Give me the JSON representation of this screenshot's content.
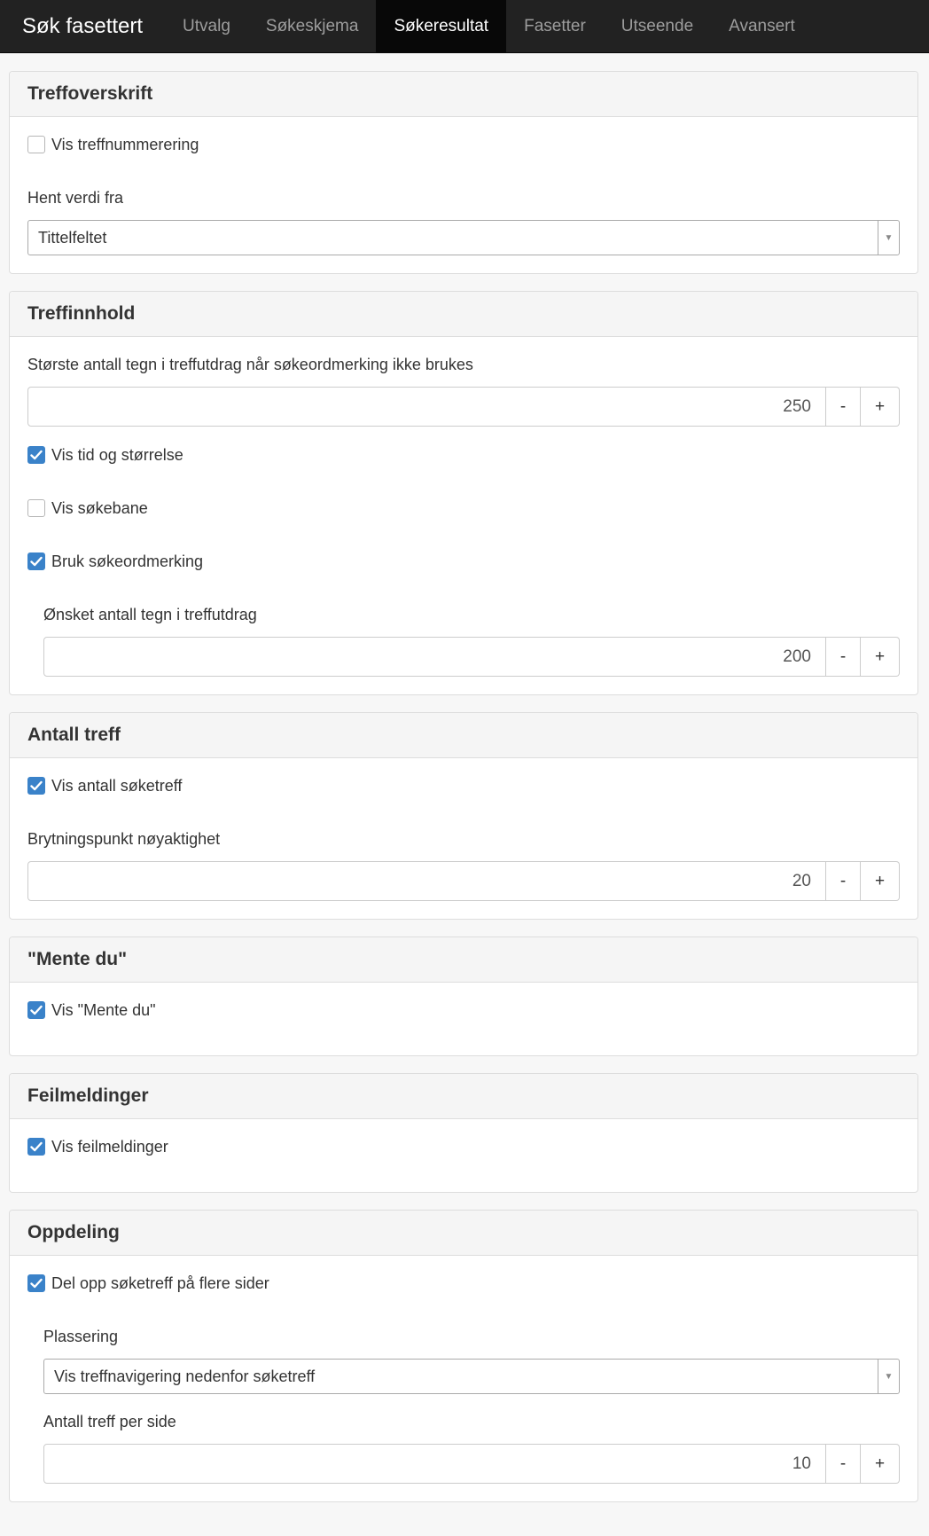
{
  "nav": {
    "brand": "Søk fasettert",
    "tabs": [
      {
        "label": "Utvalg"
      },
      {
        "label": "Søkeskjema"
      },
      {
        "label": "Søkeresultat"
      },
      {
        "label": "Fasetter"
      },
      {
        "label": "Utseende"
      },
      {
        "label": "Avansert"
      }
    ],
    "active_tab": "Søkeresultat"
  },
  "panels": {
    "treffoverskrift": {
      "title": "Treffoverskrift",
      "show_numbering": {
        "label": "Vis treffnummerering",
        "checked": false
      },
      "source": {
        "label": "Hent verdi fra",
        "value": "Tittelfeltet"
      }
    },
    "treffinnhold": {
      "title": "Treffinnhold",
      "max_chars": {
        "label": "Største antall tegn i treffutdrag når søkeordmerking ikke brukes",
        "value": "250"
      },
      "show_time_size": {
        "label": "Vis tid og størrelse",
        "checked": true
      },
      "show_path": {
        "label": "Vis søkebane",
        "checked": false
      },
      "use_highlight": {
        "label": "Bruk søkeordmerking",
        "checked": true
      },
      "desired_chars": {
        "label": "Ønsket antall tegn i treffutdrag",
        "value": "200"
      }
    },
    "antall_treff": {
      "title": "Antall treff",
      "show_count": {
        "label": "Vis antall søketreff",
        "checked": true
      },
      "breakpoint": {
        "label": "Brytningspunkt nøyaktighet",
        "value": "20"
      }
    },
    "mente_du": {
      "title": "\"Mente du\"",
      "show": {
        "label": "Vis \"Mente du\"",
        "checked": true
      }
    },
    "feilmeldinger": {
      "title": "Feilmeldinger",
      "show": {
        "label": "Vis feilmeldinger",
        "checked": true
      }
    },
    "oppdeling": {
      "title": "Oppdeling",
      "paginate": {
        "label": "Del opp søketreff på flere sider",
        "checked": true
      },
      "placement": {
        "label": "Plassering",
        "value": "Vis treffnavigering nedenfor søketreff"
      },
      "per_page": {
        "label": "Antall treff per side",
        "value": "10"
      }
    }
  },
  "spinner": {
    "minus": "-",
    "plus": "+"
  },
  "select_arrow": "▼",
  "colors": {
    "navbar": "#222222",
    "active_tab": "#080808",
    "checkbox_checked": "#3a82c9",
    "panel_heading": "#f5f5f5"
  }
}
